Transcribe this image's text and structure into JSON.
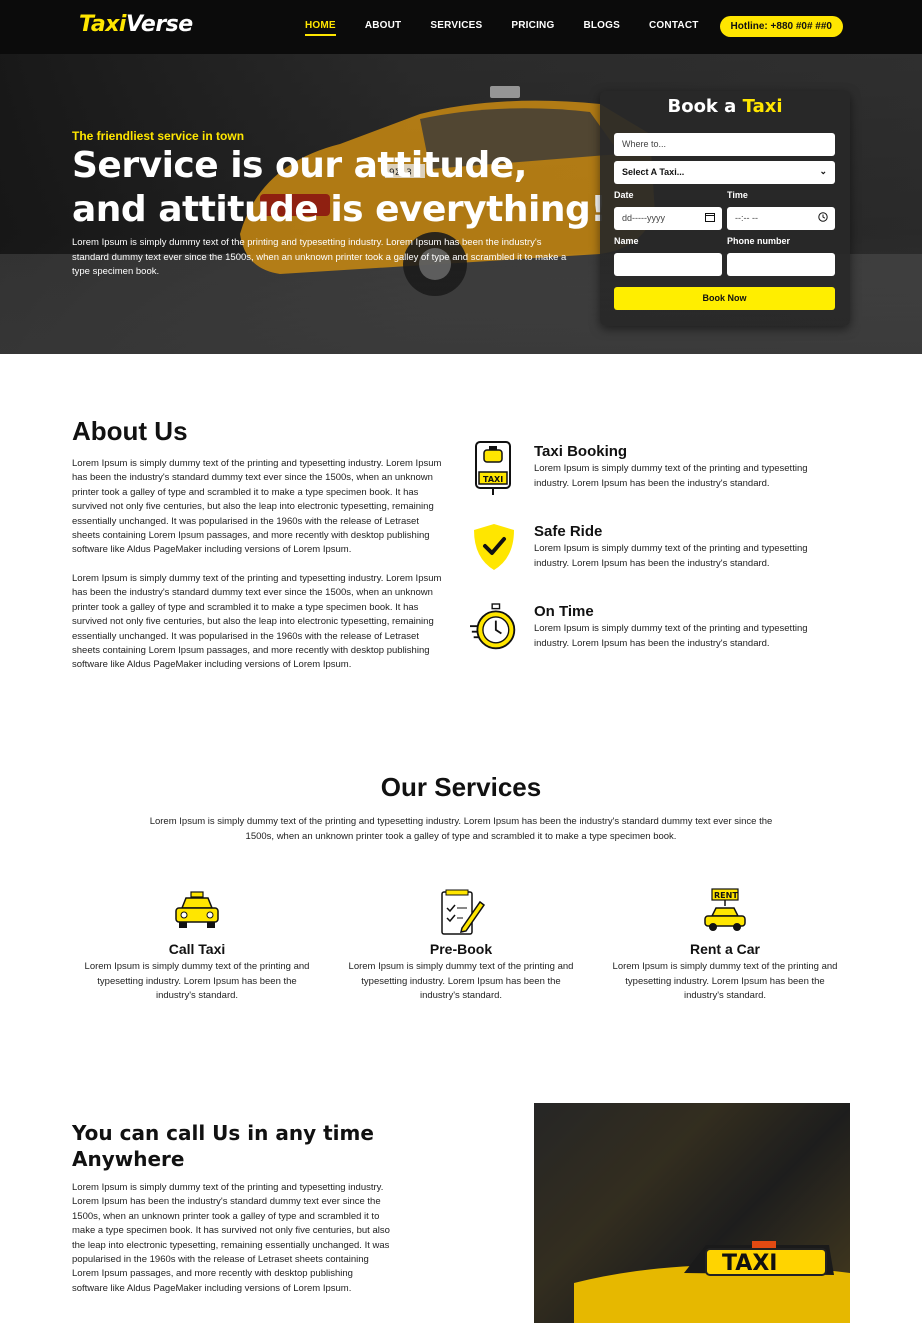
{
  "nav": {
    "logo_part1": "Taxi",
    "logo_part2": "Verse",
    "items": [
      "HOME",
      "ABOUT",
      "SERVICES",
      "PRICING",
      "BLOGS",
      "CONTACT"
    ],
    "hotline": "Hotline: +880 #0# ##0"
  },
  "hero": {
    "tagline": "The friendliest service in town",
    "title": "Service is our attitude, and attitude is everything!",
    "text": "Lorem Ipsum is simply dummy text of the printing and typesetting industry. Lorem Ipsum has been the industry's standard dummy text ever since the 1500s, when an unknown printer took a galley of type and scrambled it to make a type specimen book.",
    "plate": "9Σ13"
  },
  "booking": {
    "title_part1": "Book a",
    "title_part2": "Taxi",
    "where_placeholder": "Where to...",
    "select_value": "Select A Taxi...",
    "date_label": "Date",
    "date_value": "dd-----yyyy",
    "time_label": "Time",
    "time_value": "--:-- --",
    "name_label": "Name",
    "phone_label": "Phone number",
    "button": "Book Now"
  },
  "about": {
    "title": "About Us",
    "paragraph1": "Lorem Ipsum is simply dummy text of the printing and typesetting industry. Lorem Ipsum has been the industry's standard dummy text ever since the 1500s, when an unknown printer took a galley of type and scrambled it to make a type specimen book. It has survived not only five centuries, but also the leap into electronic typesetting, remaining essentially unchanged. It was popularised in the 1960s with the release of Letraset sheets containing Lorem Ipsum passages, and more recently with desktop publishing software like Aldus PageMaker including versions of Lorem Ipsum.",
    "paragraph2": "Lorem Ipsum is simply dummy text of the printing and typesetting industry. Lorem Ipsum has been the industry's standard dummy text ever since the 1500s, when an unknown printer took a galley of type and scrambled it to make a type specimen book. It has survived not only five centuries, but also the leap into electronic typesetting, remaining essentially unchanged. It was popularised in the 1960s with the release of Letraset sheets containing Lorem Ipsum passages, and more recently with desktop publishing software like Aldus PageMaker including versions of Lorem Ipsum.",
    "features": [
      {
        "title": "Taxi Booking",
        "text": "Lorem Ipsum is simply dummy text of the printing and typesetting industry. Lorem Ipsum has been the industry's standard.",
        "icon": "taxi-sign-icon",
        "icon_text": "TAXI"
      },
      {
        "title": "Safe Ride",
        "text": "Lorem Ipsum is simply dummy text of the printing and typesetting industry. Lorem Ipsum has been the industry's standard.",
        "icon": "shield-check-icon"
      },
      {
        "title": "On Time",
        "text": "Lorem Ipsum is simply dummy text of the printing and typesetting industry. Lorem Ipsum has been the industry's standard.",
        "icon": "stopwatch-icon"
      }
    ]
  },
  "services": {
    "title": "Our Services",
    "subtitle": "Lorem Ipsum is simply dummy text of the printing and typesetting industry. Lorem Ipsum has been the industry's standard dummy text ever since the 1500s, when an unknown printer took a galley of type and scrambled it to make a type specimen book.",
    "items": [
      {
        "name": "Call Taxi",
        "text": "Lorem Ipsum is simply dummy text of the printing and typesetting industry. Lorem Ipsum has been the industry's standard.",
        "icon": "taxi-car-icon"
      },
      {
        "name": "Pre-Book",
        "text": "Lorem Ipsum is simply dummy text of the printing and typesetting industry. Lorem Ipsum has been the industry's standard.",
        "icon": "clipboard-pencil-icon"
      },
      {
        "name": "Rent a Car",
        "text": "Lorem Ipsum is simply dummy text of the printing and typesetting industry. Lorem Ipsum has been the industry's standard.",
        "icon": "rent-car-icon",
        "icon_text": "RENT"
      }
    ]
  },
  "call": {
    "title": "You can call Us in any time Anywhere",
    "text": "Lorem Ipsum is simply dummy text of the printing and typesetting industry. Lorem Ipsum has been the industry's standard dummy text ever since the 1500s, when an unknown printer took a galley of type and scrambled it to make a type specimen book. It has survived not only five centuries, but also the leap into electronic typesetting, remaining essentially unchanged. It was popularised in the 1960s with the release of Letraset sheets containing Lorem Ipsum passages, and more recently with desktop publishing software like Aldus PageMaker including versions of Lorem Ipsum.",
    "sign_text": "TAXI"
  },
  "colors": {
    "accent": "#ffe600",
    "nav_bg": "#0b0b0b"
  }
}
